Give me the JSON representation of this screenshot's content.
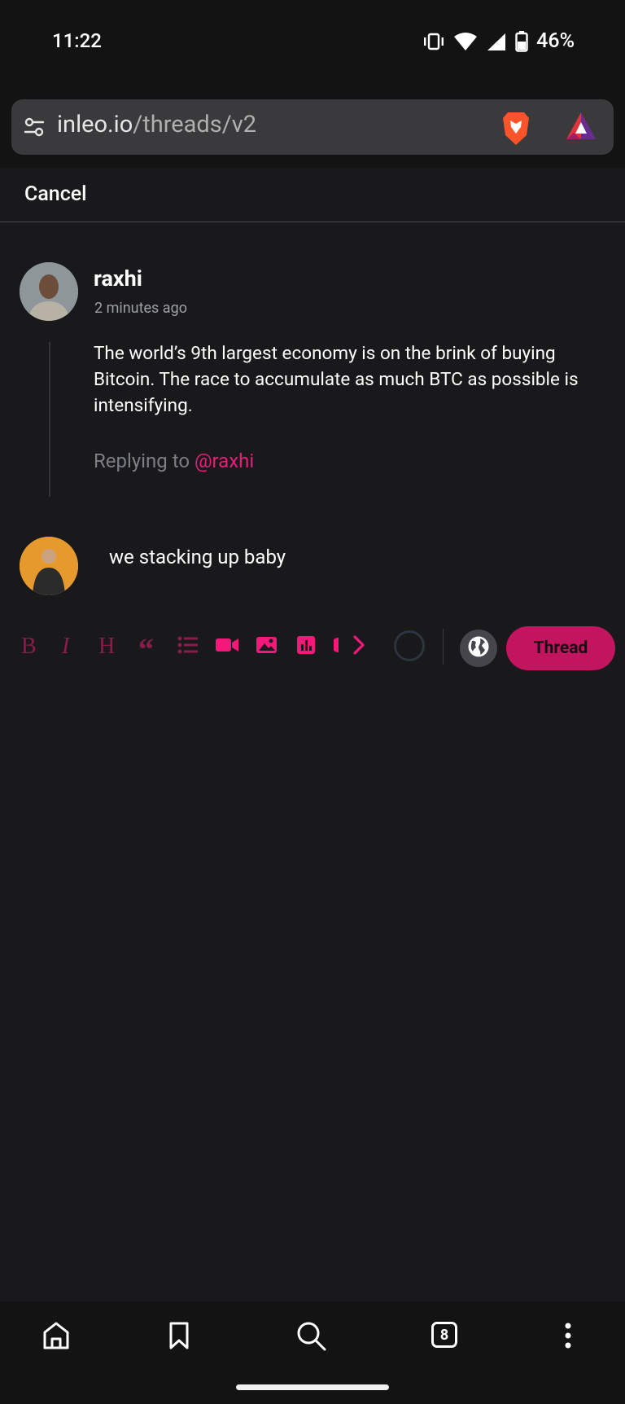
{
  "status": {
    "time": "11:22",
    "battery": "46%"
  },
  "browser": {
    "url_host": "inleo.io",
    "url_path": "/threads/v2"
  },
  "header": {
    "cancel_label": "Cancel"
  },
  "post": {
    "author": "raxhi",
    "time_ago": "2 minutes ago",
    "text": "The world’s 9th largest economy is on the brink of buying Bitcoin. The race to accumulate as much BTC as possible is intensifying.",
    "replying_prefix": "Replying to",
    "replying_mention": "@raxhi"
  },
  "composer": {
    "text": "we stacking up baby",
    "submit_label": "Thread"
  },
  "toolbar_icons": [
    "bold-icon",
    "italic-icon",
    "heading-icon",
    "quote-icon",
    "list-icon",
    "video-icon",
    "image-icon",
    "poll-icon",
    "chevron-right-icon"
  ],
  "nav": {
    "tab_count": "8"
  },
  "colors": {
    "accent": "#f2197a",
    "accent_dark": "#c2145f",
    "background": "#19191b"
  }
}
